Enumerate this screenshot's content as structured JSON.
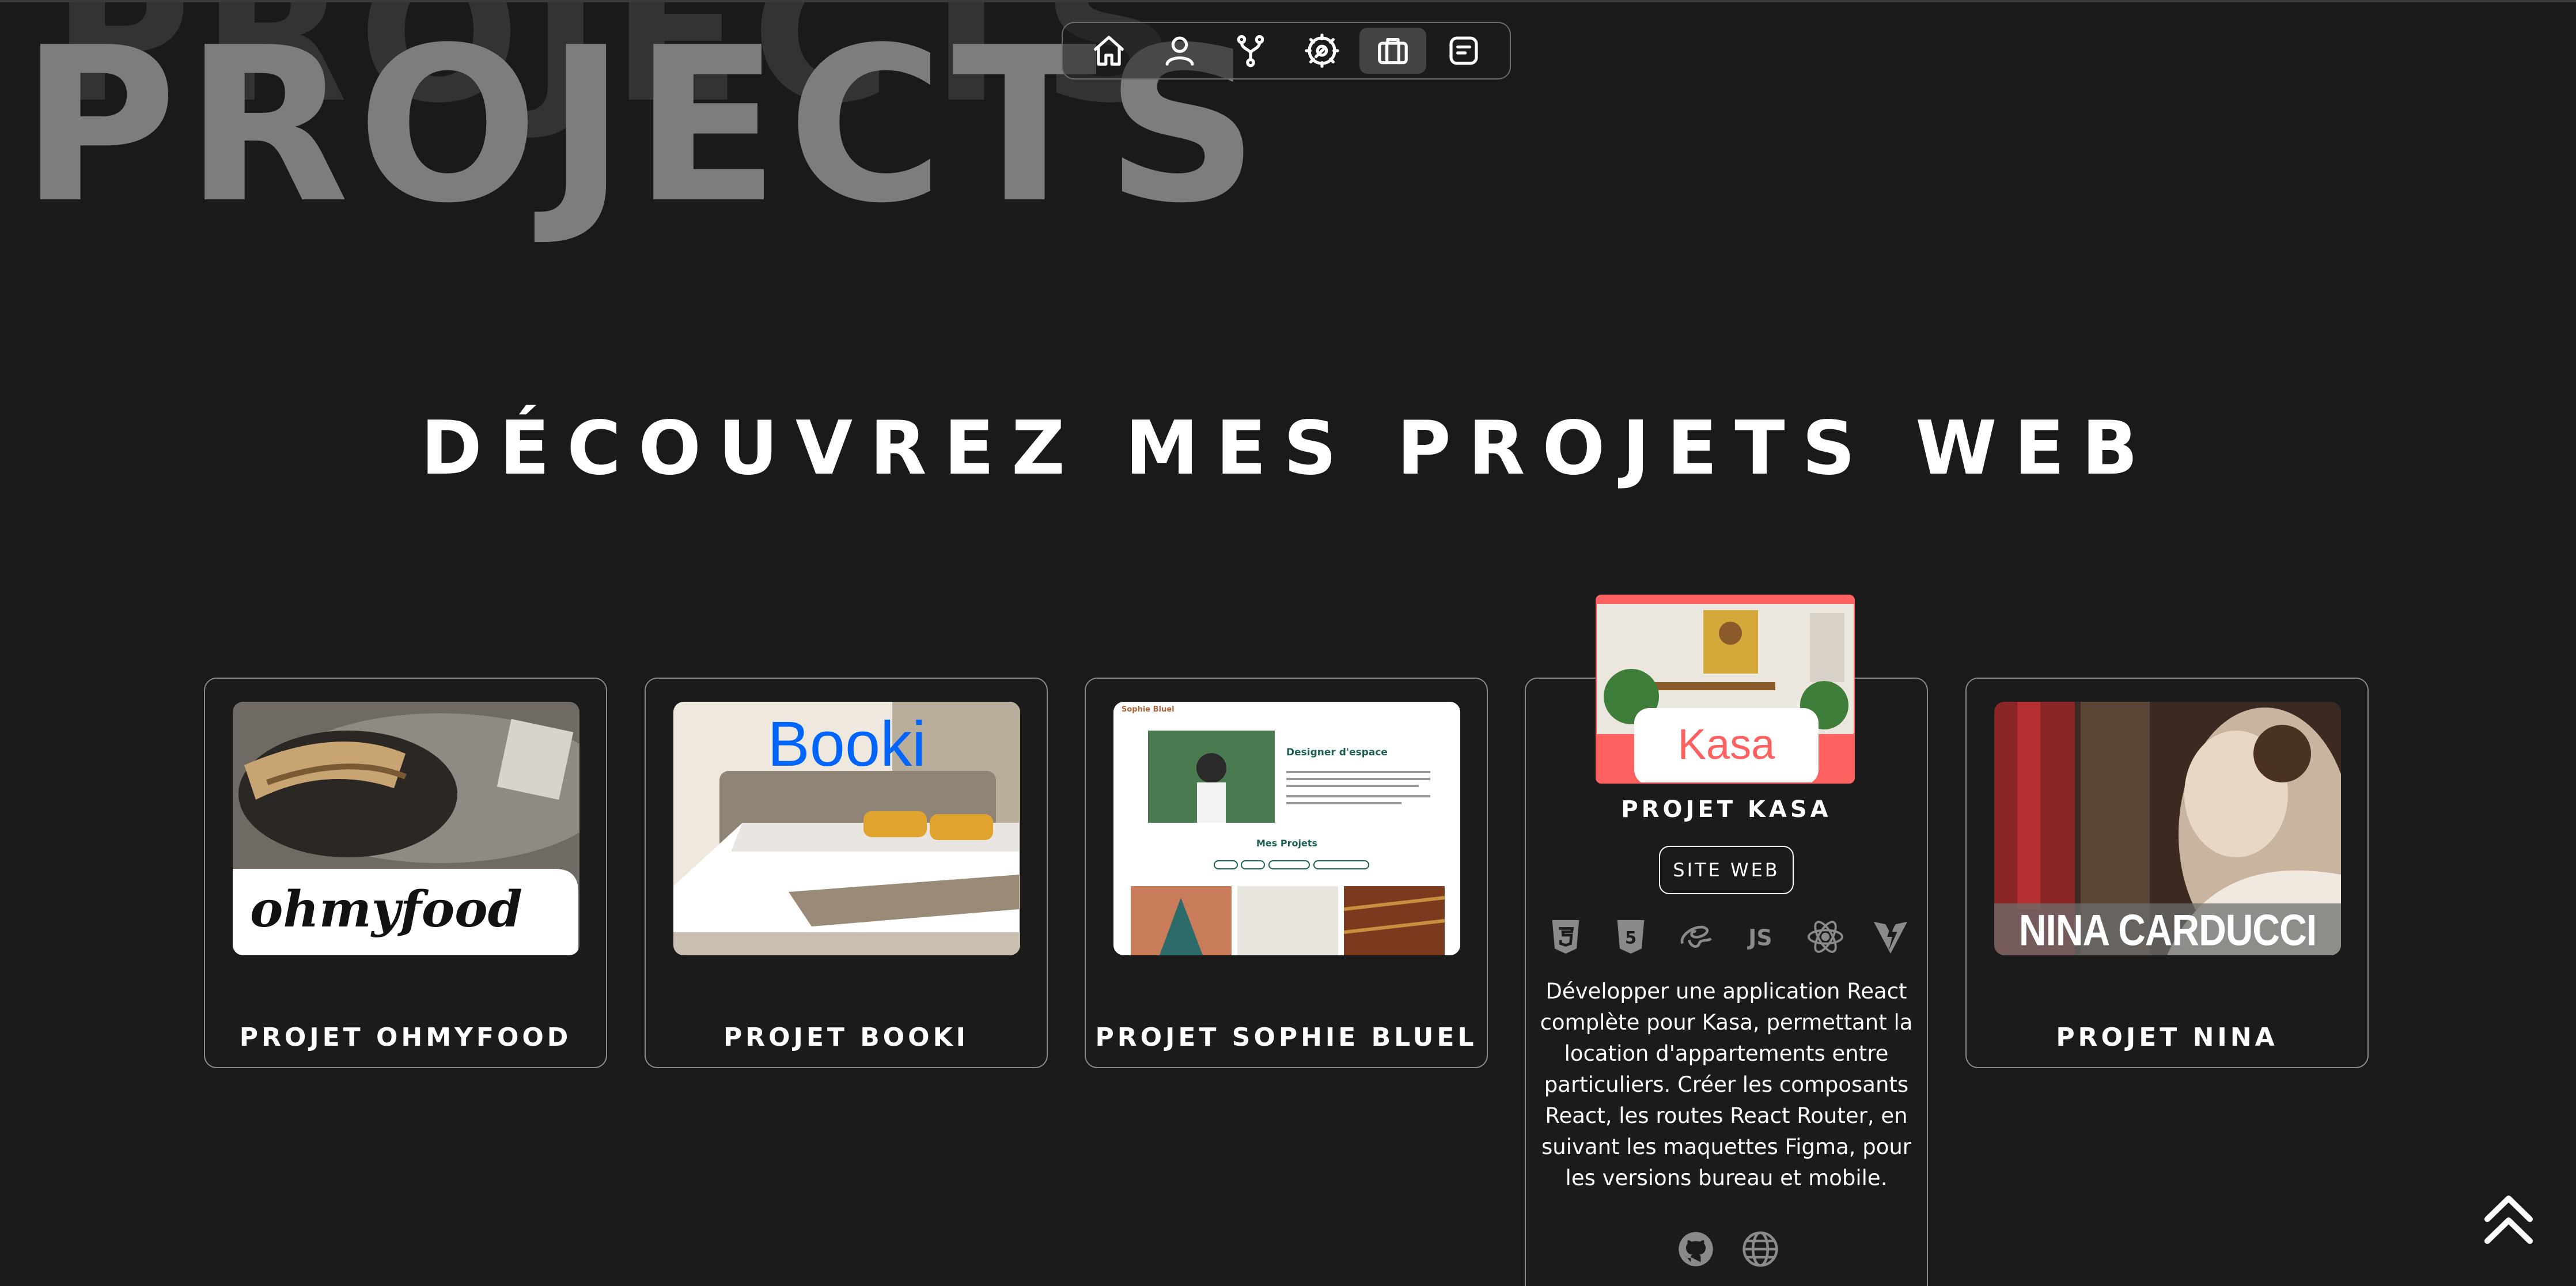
{
  "hero": {
    "ghost_title": "PROJECTS",
    "title": "PROJECTS"
  },
  "nav": {
    "items": [
      {
        "name": "home",
        "icon": "home-icon"
      },
      {
        "name": "about",
        "icon": "user-icon"
      },
      {
        "name": "skills",
        "icon": "branch-icon"
      },
      {
        "name": "services",
        "icon": "tools-icon"
      },
      {
        "name": "projects",
        "icon": "briefcase-icon",
        "active": true
      },
      {
        "name": "contact",
        "icon": "message-icon"
      }
    ]
  },
  "section": {
    "heading": "DÉCOUVREZ MES PROJETS WEB"
  },
  "projects": [
    {
      "title": "PROJET OHMYFOOD",
      "logo_text": "ohmyfood"
    },
    {
      "title": "PROJET BOOKI",
      "logo_text": "Booki"
    },
    {
      "title": "PROJET SOPHIE BLUEL",
      "logo_text": "Sophie Bluel",
      "thumb_heading": "Designer d'espace",
      "thumb_section": "Mes Projets"
    },
    {
      "title": "PROJET KASA",
      "logo_text": "Kasa",
      "button_label": "SITE WEB",
      "technologies": [
        "html5-icon",
        "css3-icon",
        "sass-icon",
        "javascript-icon",
        "react-icon",
        "vite-icon"
      ],
      "description": "Développer une application React complète pour Kasa, permettant la location d'appartements entre particuliers. Créer les composants React, les routes React Router, en suivant les maquettes Figma, pour les versions bureau et mobile.",
      "links": [
        "github-icon",
        "globe-icon"
      ]
    },
    {
      "title": "PROJET NINA",
      "logo_text": "NINA CARDUCCI"
    }
  ],
  "colors": {
    "background": "#1a1a1b",
    "hero_title": "#7d7d7d",
    "hero_ghost": "#333334",
    "card_border": "#8a8a8a",
    "kasa_accent": "#ff6060",
    "booki_blue": "#0065fc"
  }
}
